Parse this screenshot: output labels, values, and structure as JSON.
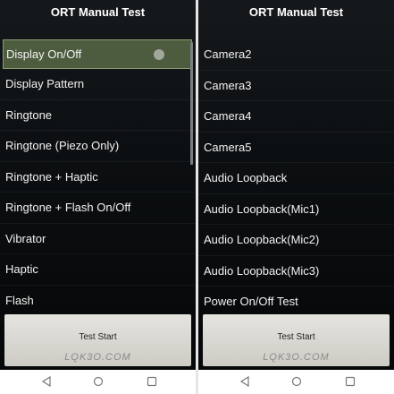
{
  "left": {
    "title": "ORT Manual Test",
    "items": [
      "Display On/Off",
      "Display Pattern",
      "Ringtone",
      "Ringtone (Piezo Only)",
      "Ringtone + Haptic",
      "Ringtone + Flash On/Off",
      "Vibrator",
      "Haptic",
      "Flash"
    ],
    "selected_index": 0,
    "button_label": "Test Start",
    "watermark": "LQK3O.COM"
  },
  "right": {
    "title": "ORT Manual Test",
    "items": [
      "Camera2",
      "Camera3",
      "Camera4",
      "Camera5",
      "Audio Loopback",
      "Audio Loopback(Mic1)",
      "Audio Loopback(Mic2)",
      "Audio Loopback(Mic3)",
      "Power On/Off Test"
    ],
    "button_label": "Test Start",
    "watermark": "LQK3O.COM"
  },
  "navbar": {
    "icons": [
      "back-icon",
      "home-icon",
      "recent-apps-icon"
    ]
  },
  "colors": {
    "selected_bg": "#4d5c3f",
    "selected_border": "#8a9a6e",
    "button_bg": "#dcdad4"
  }
}
